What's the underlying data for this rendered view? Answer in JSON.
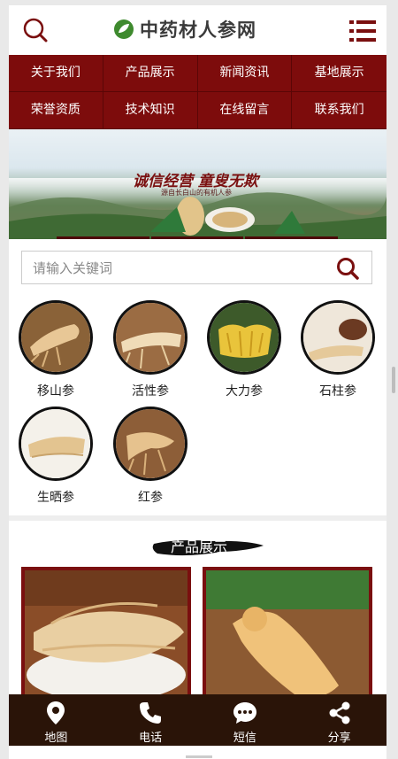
{
  "header": {
    "logo_text": "中药材人参网",
    "search_icon": "search-icon",
    "menu_icon": "list-menu-icon"
  },
  "nav": {
    "items": [
      {
        "label": "关于我们"
      },
      {
        "label": "产品展示"
      },
      {
        "label": "新闻资讯"
      },
      {
        "label": "基地展示"
      },
      {
        "label": "荣誉资质"
      },
      {
        "label": "技术知识"
      },
      {
        "label": "在线留言"
      },
      {
        "label": "联系我们"
      }
    ]
  },
  "banner": {
    "slogan": "诚信经营 童叟无欺",
    "subtitle": "源自长白山的有机人参"
  },
  "search": {
    "placeholder": "请输入关键词",
    "value": ""
  },
  "categories": [
    {
      "label": "移山参"
    },
    {
      "label": "活性参"
    },
    {
      "label": "大力参"
    },
    {
      "label": "石柱参"
    },
    {
      "label": "生晒参"
    },
    {
      "label": "红参"
    }
  ],
  "products_section": {
    "title": "产品展示"
  },
  "footer": {
    "items": [
      {
        "label": "地图",
        "icon": "map-pin-icon"
      },
      {
        "label": "电话",
        "icon": "phone-icon"
      },
      {
        "label": "短信",
        "icon": "message-icon"
      },
      {
        "label": "分享",
        "icon": "share-icon"
      }
    ]
  },
  "colors": {
    "brand": "#7d0c0c",
    "footer_bg": "#2a1408"
  }
}
